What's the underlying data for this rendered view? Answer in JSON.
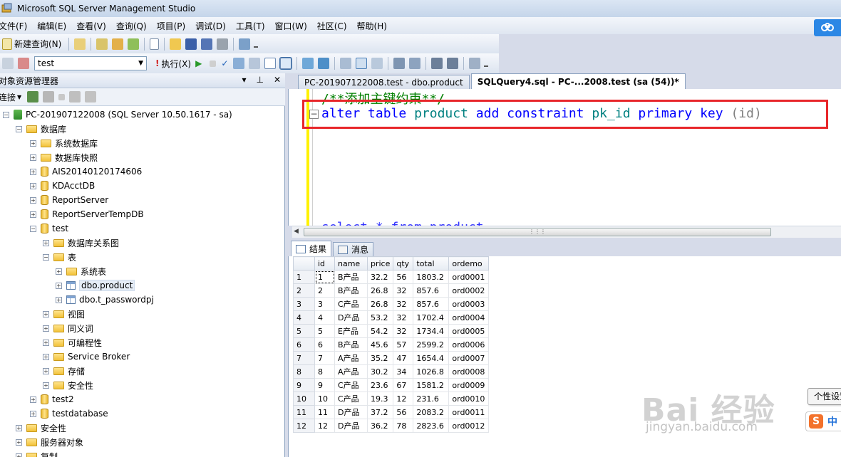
{
  "window": {
    "title": "Microsoft SQL Server Management Studio"
  },
  "menu": [
    "文件(F)",
    "编辑(E)",
    "查看(V)",
    "查询(Q)",
    "项目(P)",
    "调试(D)",
    "工具(T)",
    "窗口(W)",
    "社区(C)",
    "帮助(H)"
  ],
  "toolbar": {
    "new_query_label": "新建查询(N)",
    "database": "test",
    "execute_label": "执行(X)"
  },
  "object_explorer": {
    "title": "对象资源管理器",
    "connect_label": "连接",
    "tree": [
      {
        "label": "PC-201907122008 (SQL Server 10.50.1617 - sa)",
        "icon": "server-icon",
        "level": 0,
        "expanded": true
      },
      {
        "label": "数据库",
        "icon": "folder-icon",
        "level": 1,
        "expanded": true
      },
      {
        "label": "系统数据库",
        "icon": "folder-icon",
        "level": 2,
        "expanded": false
      },
      {
        "label": "数据库快照",
        "icon": "folder-icon",
        "level": 2,
        "expanded": false
      },
      {
        "label": "AIS20140120174606",
        "icon": "database-icon",
        "level": 2,
        "expanded": false
      },
      {
        "label": "KDAcctDB",
        "icon": "database-icon",
        "level": 2,
        "expanded": false
      },
      {
        "label": "ReportServer",
        "icon": "database-icon",
        "level": 2,
        "expanded": false
      },
      {
        "label": "ReportServerTempDB",
        "icon": "database-icon",
        "level": 2,
        "expanded": false
      },
      {
        "label": "test",
        "icon": "database-icon",
        "level": 2,
        "expanded": true
      },
      {
        "label": "数据库关系图",
        "icon": "folder-icon",
        "level": 3,
        "expanded": false
      },
      {
        "label": "表",
        "icon": "folder-icon",
        "level": 3,
        "expanded": true
      },
      {
        "label": "系统表",
        "icon": "folder-icon",
        "level": 4,
        "expanded": false
      },
      {
        "label": "dbo.product",
        "icon": "table-icon",
        "level": 4,
        "expanded": false,
        "selected": true
      },
      {
        "label": "dbo.t_passwordpj",
        "icon": "table-icon",
        "level": 4,
        "expanded": false
      },
      {
        "label": "视图",
        "icon": "folder-icon",
        "level": 3,
        "expanded": false
      },
      {
        "label": "同义词",
        "icon": "folder-icon",
        "level": 3,
        "expanded": false
      },
      {
        "label": "可编程性",
        "icon": "folder-icon",
        "level": 3,
        "expanded": false
      },
      {
        "label": "Service Broker",
        "icon": "folder-icon",
        "level": 3,
        "expanded": false
      },
      {
        "label": "存储",
        "icon": "folder-icon",
        "level": 3,
        "expanded": false
      },
      {
        "label": "安全性",
        "icon": "folder-icon",
        "level": 3,
        "expanded": false
      },
      {
        "label": "test2",
        "icon": "database-icon",
        "level": 2,
        "expanded": false
      },
      {
        "label": "testdatabase",
        "icon": "database-icon",
        "level": 2,
        "expanded": false
      },
      {
        "label": "安全性",
        "icon": "folder-icon",
        "level": 1,
        "expanded": false
      },
      {
        "label": "服务器对象",
        "icon": "folder-icon",
        "level": 1,
        "expanded": false
      },
      {
        "label": "复制",
        "icon": "folder-icon",
        "level": 1,
        "expanded": false
      }
    ]
  },
  "tabs": [
    {
      "label": "PC-201907122008.test - dbo.product",
      "active": false
    },
    {
      "label": "SQLQuery4.sql - PC-...2008.test (sa (54))*",
      "active": true
    }
  ],
  "editor": {
    "comment": "/**添加主键约束**/",
    "statement": {
      "t1": "alter",
      "t2": "table",
      "t3": "product",
      "t4": "add",
      "t5": "constraint",
      "t6": "pk_id",
      "t7": "primary",
      "t8": "key",
      "t9": "(id)"
    },
    "partial_bottom_line": "select * from product"
  },
  "results": {
    "tabs": [
      "结果",
      "消息"
    ],
    "columns": [
      "id",
      "name",
      "price",
      "qty",
      "total",
      "ordemo"
    ],
    "rows": [
      [
        "1",
        "1",
        "B产品",
        "32.2",
        "56",
        "1803.2",
        "ord0001"
      ],
      [
        "2",
        "2",
        "B产品",
        "26.8",
        "32",
        "857.6",
        "ord0002"
      ],
      [
        "3",
        "3",
        "C产品",
        "26.8",
        "32",
        "857.6",
        "ord0003"
      ],
      [
        "4",
        "4",
        "D产品",
        "53.2",
        "32",
        "1702.4",
        "ord0004"
      ],
      [
        "5",
        "5",
        "E产品",
        "54.2",
        "32",
        "1734.4",
        "ord0005"
      ],
      [
        "6",
        "6",
        "B产品",
        "45.6",
        "57",
        "2599.2",
        "ord0006"
      ],
      [
        "7",
        "7",
        "A产品",
        "35.2",
        "47",
        "1654.4",
        "ord0007"
      ],
      [
        "8",
        "8",
        "A产品",
        "30.2",
        "34",
        "1026.8",
        "ord0008"
      ],
      [
        "9",
        "9",
        "C产品",
        "23.6",
        "67",
        "1581.2",
        "ord0009"
      ],
      [
        "10",
        "10",
        "C产品",
        "19.3",
        "12",
        "231.6",
        "ord0010"
      ],
      [
        "11",
        "11",
        "D产品",
        "37.2",
        "56",
        "2083.2",
        "ord0011"
      ],
      [
        "12",
        "12",
        "D产品",
        "36.2",
        "78",
        "2823.6",
        "ord0012"
      ]
    ]
  },
  "overlay": {
    "tooltip": "个性设置",
    "ime_label": "中",
    "watermark_big": "Bai 经验",
    "watermark_small": "jingyan.baidu.com"
  }
}
